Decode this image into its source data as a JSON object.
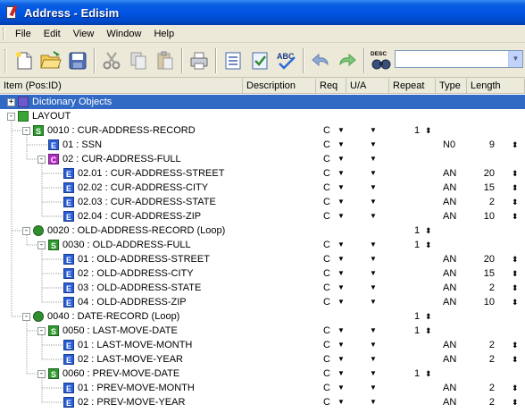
{
  "window": {
    "title": "Address - Edisim"
  },
  "menu": [
    "File",
    "Edit",
    "View",
    "Window",
    "Help"
  ],
  "toolbar": {
    "buttons": [
      "new-file-icon",
      "open-folder-icon",
      "save-icon",
      "cut-icon",
      "copy-icon",
      "paste-icon",
      "print-icon",
      "list-icon",
      "check-icon",
      "spellcheck-icon",
      "undo-icon",
      "redo-icon",
      "descriptions-icon"
    ],
    "spellcheck_text": "ABC",
    "desc_text": "DESC",
    "search_value": ""
  },
  "grid": {
    "columns": [
      "Item (Pos:ID)",
      "Description",
      "Req",
      "U/A",
      "Repeat",
      "Type",
      "Length"
    ],
    "rows": [
      {
        "depth": 0,
        "expander": "+",
        "badge": "D",
        "label": "Dictionary Objects",
        "selected": true,
        "req": "",
        "ua": false,
        "repeat": "",
        "type": "",
        "length": ""
      },
      {
        "depth": 0,
        "expander": "-",
        "badge": "L",
        "label": "LAYOUT",
        "req": "",
        "ua": false,
        "repeat": "",
        "type": "",
        "length": ""
      },
      {
        "depth": 1,
        "expander": "-",
        "badge": "S",
        "label": "0010 : CUR-ADDRESS-RECORD",
        "req": "C",
        "ua": true,
        "repeat": "1",
        "type": "",
        "length": ""
      },
      {
        "depth": 2,
        "expander": "",
        "badge": "E",
        "label": "01 : SSN",
        "req": "C",
        "ua": true,
        "repeat": "",
        "type": "N0",
        "length": "9"
      },
      {
        "depth": 2,
        "expander": "-",
        "badge": "C",
        "label": "02 : CUR-ADDRESS-FULL",
        "req": "C",
        "ua": true,
        "repeat": "",
        "type": "",
        "length": ""
      },
      {
        "depth": 3,
        "expander": "",
        "badge": "E",
        "label": "02.01 : CUR-ADDRESS-STREET",
        "req": "C",
        "ua": true,
        "repeat": "",
        "type": "AN",
        "length": "20"
      },
      {
        "depth": 3,
        "expander": "",
        "badge": "E",
        "label": "02.02 : CUR-ADDRESS-CITY",
        "req": "C",
        "ua": true,
        "repeat": "",
        "type": "AN",
        "length": "15"
      },
      {
        "depth": 3,
        "expander": "",
        "badge": "E",
        "label": "02.03 : CUR-ADDRESS-STATE",
        "req": "C",
        "ua": true,
        "repeat": "",
        "type": "AN",
        "length": "2"
      },
      {
        "depth": 3,
        "expander": "",
        "badge": "E",
        "label": "02.04 : CUR-ADDRESS-ZIP",
        "req": "C",
        "ua": true,
        "repeat": "",
        "type": "AN",
        "length": "10"
      },
      {
        "depth": 1,
        "expander": "-",
        "badge": "G",
        "label": "0020 : OLD-ADDRESS-RECORD (Loop)",
        "req": "",
        "ua": false,
        "repeat": "1",
        "type": "",
        "length": ""
      },
      {
        "depth": 2,
        "expander": "-",
        "badge": "S",
        "label": "0030 : OLD-ADDRESS-FULL",
        "req": "C",
        "ua": true,
        "repeat": "1",
        "type": "",
        "length": ""
      },
      {
        "depth": 3,
        "expander": "",
        "badge": "E",
        "label": "01 : OLD-ADDRESS-STREET",
        "req": "C",
        "ua": true,
        "repeat": "",
        "type": "AN",
        "length": "20"
      },
      {
        "depth": 3,
        "expander": "",
        "badge": "E",
        "label": "02 : OLD-ADDRESS-CITY",
        "req": "C",
        "ua": true,
        "repeat": "",
        "type": "AN",
        "length": "15"
      },
      {
        "depth": 3,
        "expander": "",
        "badge": "E",
        "label": "03 : OLD-ADDRESS-STATE",
        "req": "C",
        "ua": true,
        "repeat": "",
        "type": "AN",
        "length": "2"
      },
      {
        "depth": 3,
        "expander": "",
        "badge": "E",
        "label": "04 : OLD-ADDRESS-ZIP",
        "req": "C",
        "ua": true,
        "repeat": "",
        "type": "AN",
        "length": "10"
      },
      {
        "depth": 1,
        "expander": "-",
        "badge": "G",
        "label": "0040 : DATE-RECORD (Loop)",
        "req": "",
        "ua": false,
        "repeat": "1",
        "type": "",
        "length": ""
      },
      {
        "depth": 2,
        "expander": "-",
        "badge": "S",
        "label": "0050 : LAST-MOVE-DATE",
        "req": "C",
        "ua": true,
        "repeat": "1",
        "type": "",
        "length": ""
      },
      {
        "depth": 3,
        "expander": "",
        "badge": "E",
        "label": "01 : LAST-MOVE-MONTH",
        "req": "C",
        "ua": true,
        "repeat": "",
        "type": "AN",
        "length": "2"
      },
      {
        "depth": 3,
        "expander": "",
        "badge": "E",
        "label": "02 : LAST-MOVE-YEAR",
        "req": "C",
        "ua": true,
        "repeat": "",
        "type": "AN",
        "length": "2"
      },
      {
        "depth": 2,
        "expander": "-",
        "badge": "S",
        "label": "0060 : PREV-MOVE-DATE",
        "req": "C",
        "ua": true,
        "repeat": "1",
        "type": "",
        "length": ""
      },
      {
        "depth": 3,
        "expander": "",
        "badge": "E",
        "label": "01 : PREV-MOVE-MONTH",
        "req": "C",
        "ua": true,
        "repeat": "",
        "type": "AN",
        "length": "2"
      },
      {
        "depth": 3,
        "expander": "",
        "badge": "E",
        "label": "02 : PREV-MOVE-YEAR",
        "req": "C",
        "ua": true,
        "repeat": "",
        "type": "AN",
        "length": "2"
      }
    ]
  },
  "colors": {
    "titlebar": "#0054e3",
    "selection": "#316ac5",
    "element_badge": "#2a5ed8",
    "segment_badge": "#2f9a2f",
    "composite_badge": "#b02cc2"
  }
}
